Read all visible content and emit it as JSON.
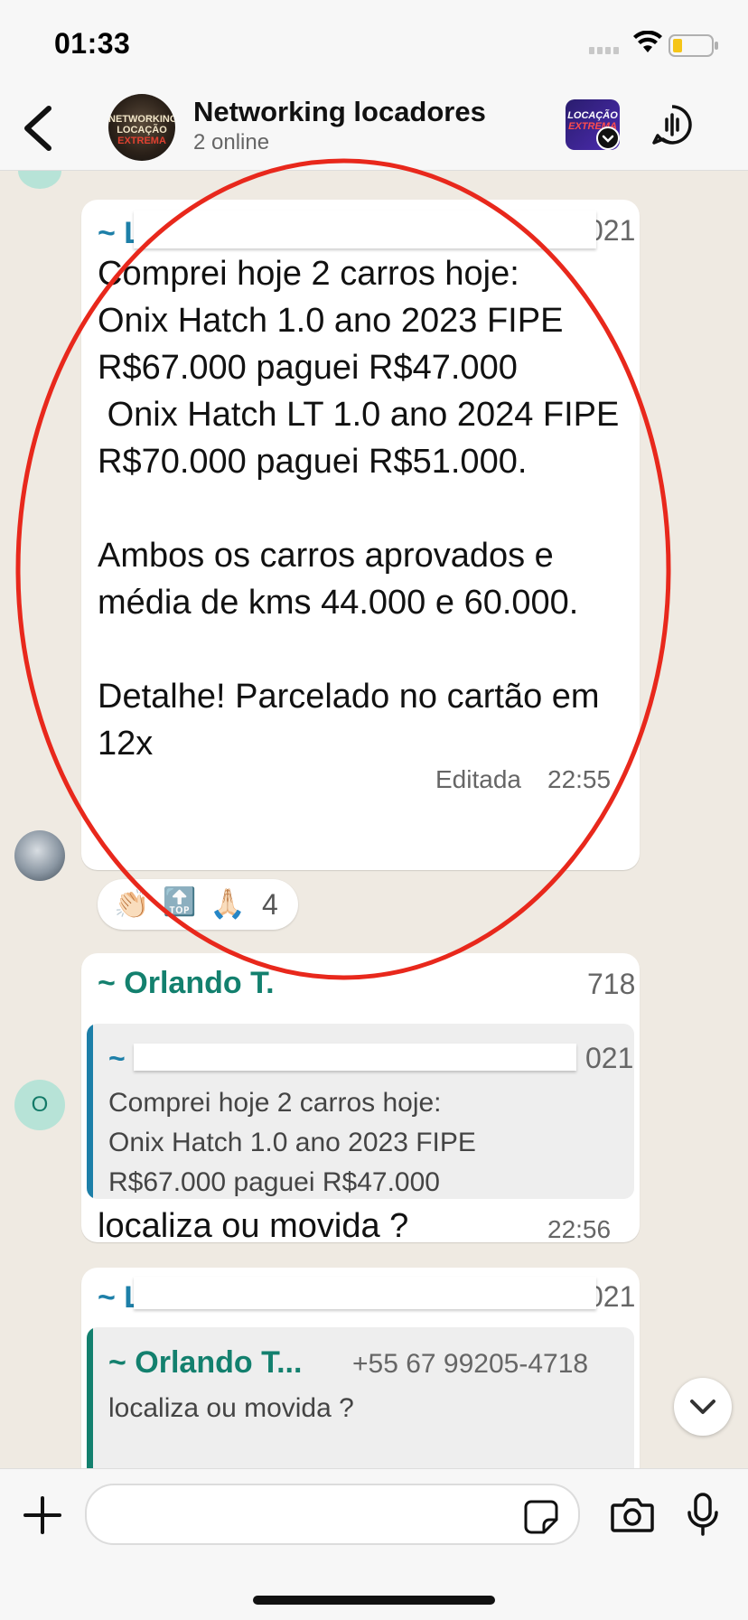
{
  "status_bar": {
    "time": "01:33"
  },
  "header": {
    "title": "Networking locadores",
    "subtitle": "2 online",
    "group_avatar_text": "NETWORKING LOCAÇÃO EXTREMA",
    "community_icon_text": "LOCAÇÃO EXTREMA"
  },
  "messages": [
    {
      "sender": "~ Le",
      "sender_phone_tail": "021",
      "text": "Comprei hoje 2 carros hoje:\nOnix Hatch 1.0 ano 2023 FIPE R$67.000 paguei R$47.000\n Onix Hatch LT 1.0 ano 2024 FIPE R$70.000 paguei R$51.000.\n\nAmbos os carros aprovados e média de kms 44.000 e 60.000.\n\nDetalhe! Parcelado no cartão em 12x",
      "edited_label": "Editada",
      "time": "22:55",
      "reactions": {
        "emojis": [
          "👏🏻",
          "🔝",
          "🙏🏻"
        ],
        "count": "4"
      }
    },
    {
      "sender": "~ Orlando T.",
      "sender_phone_tail": "718",
      "avatar_initial": "O",
      "quote": {
        "sender": "~ L",
        "sender_phone_tail": "021",
        "text": "Comprei hoje 2 carros hoje:\nOnix Hatch 1.0 ano 2023 FIPE\nR$67.000 paguei R$47.000"
      },
      "text": "localiza ou movida ?",
      "time": "22:56"
    },
    {
      "sender": "~ Le",
      "sender_phone_tail": "021",
      "quote": {
        "sender": "~ Orlando T...",
        "sender_phone": "+55 67 99205-4718",
        "text": "localiza ou movida ?"
      }
    }
  ],
  "colors": {
    "sender_blue": "#1d7fa8",
    "sender_green": "#13806e",
    "annotation_red": "#e8281c",
    "chat_background": "#efeae2"
  }
}
